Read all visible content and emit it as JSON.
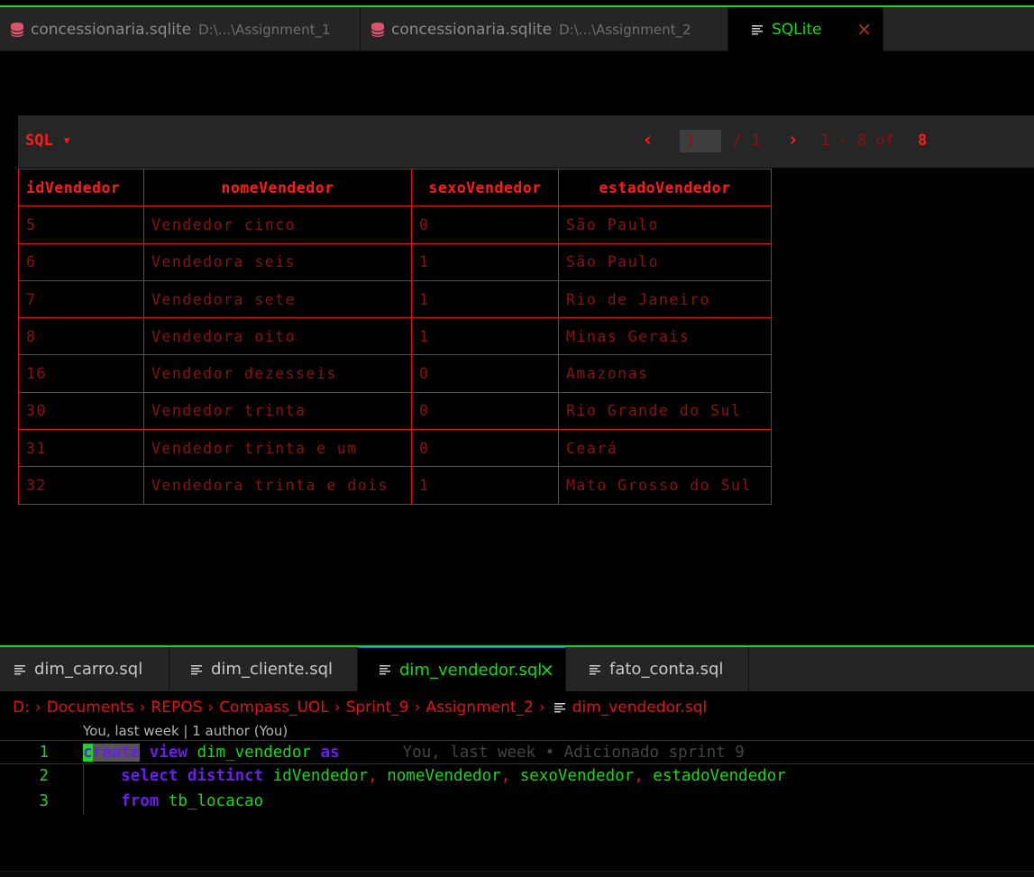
{
  "top_tabs": [
    {
      "title": "concessionaria.sqlite",
      "path": "D:\\...\\Assignment_1"
    },
    {
      "title": "concessionaria.sqlite",
      "path": "D:\\...\\Assignment_2"
    },
    {
      "title": "SQLite",
      "close": "×"
    }
  ],
  "preview": {
    "sql_menu": "SQL ▾",
    "prev": "‹",
    "next": "›",
    "page_value": "1",
    "page_total": "/ 1",
    "range": "1 - 8 of",
    "count": "8"
  },
  "table": {
    "headers": [
      "idVendedor",
      "nomeVendedor",
      "sexoVendedor",
      "estadoVendedor"
    ],
    "rows": [
      [
        "5",
        "Vendedor cinco",
        "0",
        "São Paulo"
      ],
      [
        "6",
        "Vendedora seis",
        "1",
        "São Paulo"
      ],
      [
        "7",
        "Vendedora sete",
        "1",
        "Rio de Janeiro"
      ],
      [
        "8",
        "Vendedora oito",
        "1",
        "Minas Gerais"
      ],
      [
        "16",
        "Vendedor dezesseis",
        "0",
        "Amazonas"
      ],
      [
        "30",
        "Vendedor trinta",
        "0",
        "Rio Grande do Sul"
      ],
      [
        "31",
        "Vendedor trinta e um",
        "0",
        "Ceará"
      ],
      [
        "32",
        "Vendedora trinta e dois",
        "1",
        "Mato Grosso do Sul"
      ]
    ]
  },
  "bottom_tabs": [
    {
      "label": "dim_carro.sql"
    },
    {
      "label": "dim_cliente.sql"
    },
    {
      "label": "dim_vendedor.sql",
      "close": "×"
    },
    {
      "label": "fato_conta.sql"
    }
  ],
  "breadcrumb": [
    "D:",
    "Documents",
    "REPOS",
    "Compass_UOL",
    "Sprint_9",
    "Assignment_2",
    "dim_vendedor.sql"
  ],
  "breadcrumb_sep": "›",
  "codelens": "You, last week | 1 author (You)",
  "code": {
    "line_numbers": [
      "1",
      "2",
      "3"
    ],
    "l1": {
      "cursor": "c",
      "kw1": "reate",
      "kw2": "view",
      "name": "dim_vendedor",
      "kw3": "as",
      "blame": "You, last week • Adicionado sprint 9"
    },
    "l2": {
      "kw1": "select",
      "kw2": "distinct",
      "c1": "idVendedor",
      "c2": "nomeVendedor",
      "c3": "sexoVendedor",
      "c4": "estadoVendedor",
      "comma": ","
    },
    "l3": {
      "kw": "from",
      "table": "tb_locacao"
    }
  },
  "colors": {
    "accent": "#1dd61d",
    "error_red": "#e01414",
    "keyword": "#6a1fe6"
  }
}
